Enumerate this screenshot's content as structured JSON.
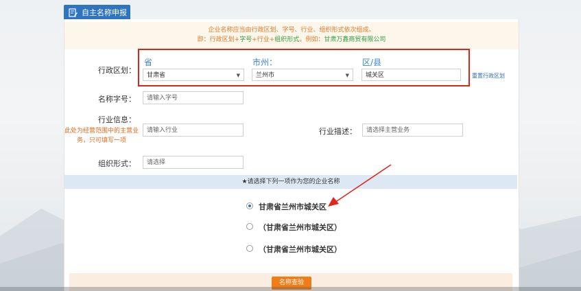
{
  "tab": {
    "label": "自主名称申报"
  },
  "notice": {
    "line1": "企业名称应当由行政区划、字号、行业、组织形式依次组成。",
    "line2_prefix": "即：行政区划+",
    "line2_part1": "字号",
    "line2_part2": "+行业+",
    "line2_part3": "组织形式",
    "line2_mid": "。例如：",
    "line2_example": "甘肃万鑫商贸有限公司"
  },
  "region": {
    "label": "行政区划：",
    "province_label": "省",
    "city_label": "市州：",
    "district_label": "区/县",
    "province_value": "甘肃省",
    "city_value": "兰州市",
    "district_value": "城关区",
    "reset_link": "重置行政区划"
  },
  "name_field": {
    "label": "名称字号：",
    "placeholder": "请输入字号"
  },
  "industry": {
    "label": "行业信息：",
    "hint": "此处为经营范围中的主营业务，只可填写一项",
    "placeholder": "请输入行业",
    "desc_label": "行业描述：",
    "desc_placeholder": "请选择主营业务"
  },
  "org": {
    "label": "组织形式：",
    "placeholder": "请选择"
  },
  "choose_bar": "★请选择下列一项作为您的企业名称",
  "options": [
    {
      "text": "甘肃省兰州市城关区",
      "selected": true
    },
    {
      "text": "（甘肃省兰州市城关区）",
      "selected": false
    },
    {
      "text": "（甘肃省兰州市城关区）",
      "selected": false
    }
  ],
  "check_button": "名称查验",
  "colors": {
    "tab_blue": "#2f74c0",
    "highlight_red": "#d9261c",
    "button_orange": "#f07d17"
  }
}
